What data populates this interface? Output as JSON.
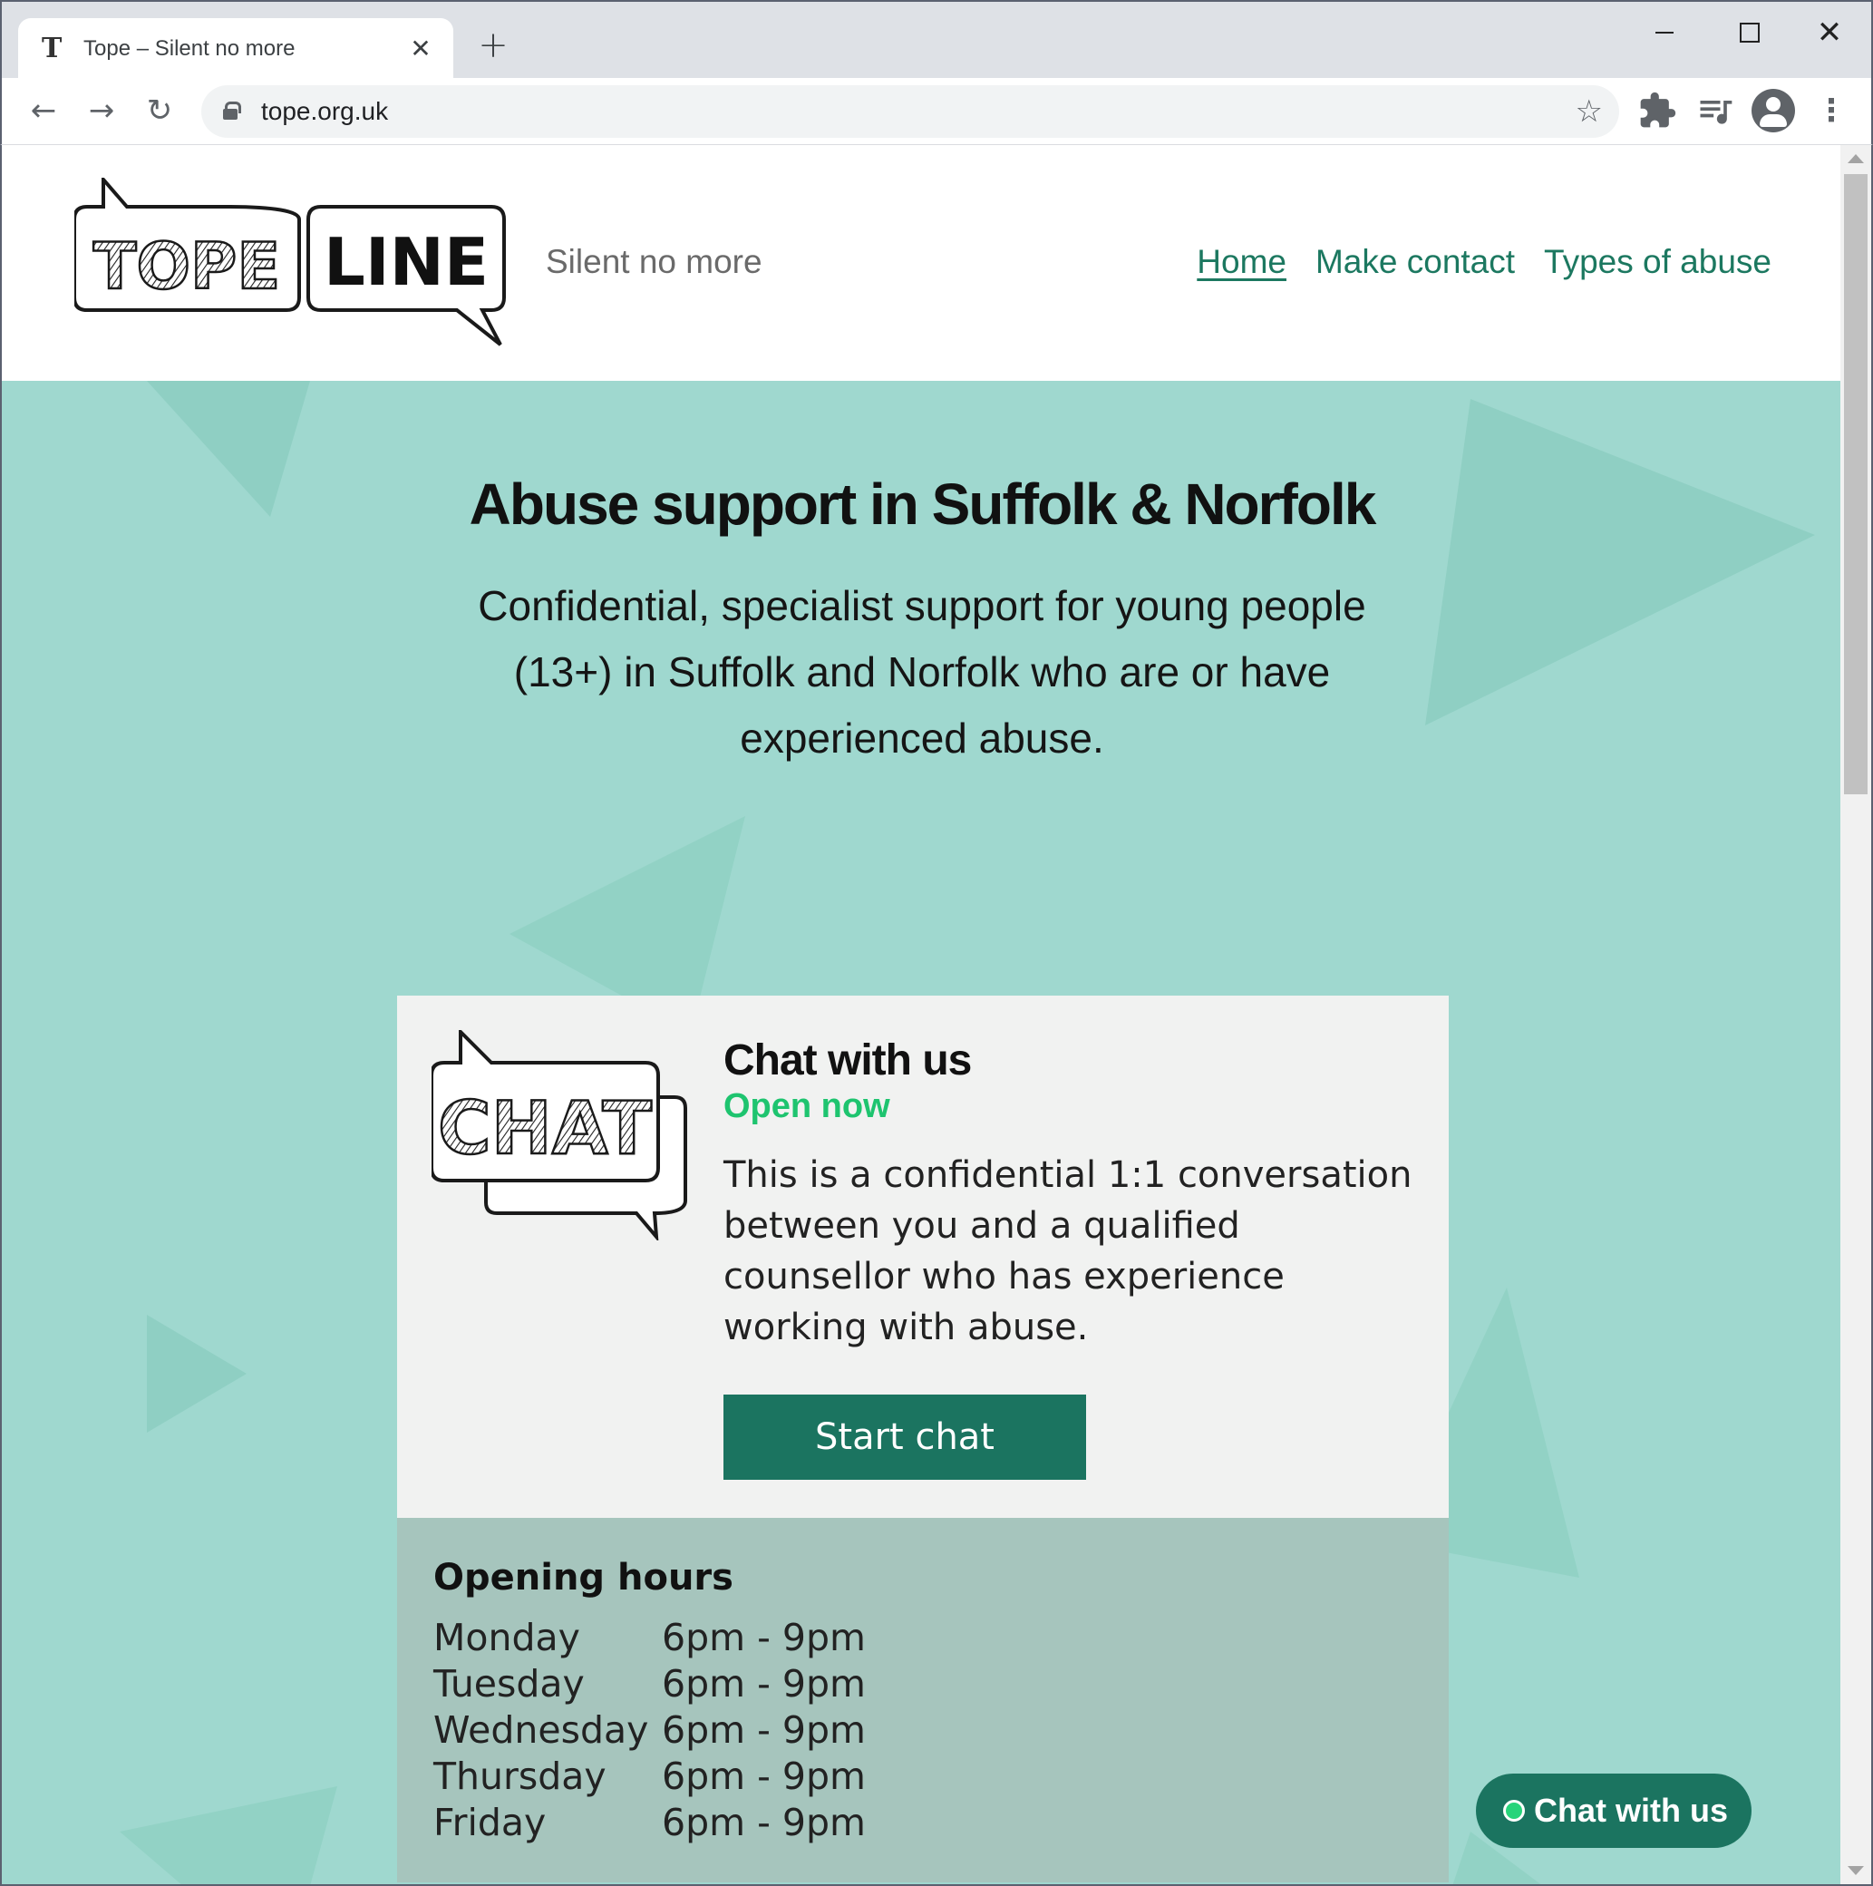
{
  "browser": {
    "tab_title": "Tope – Silent no more",
    "tab_favicon": "T",
    "url": "tope.org.uk",
    "icons": {
      "back": "arrow-left",
      "forward": "arrow-right",
      "reload": "reload",
      "lock": "lock",
      "bookmark": "star",
      "extensions": "puzzle",
      "media": "media-queue",
      "profile": "account-circle",
      "menu": "kebab-menu"
    }
  },
  "site": {
    "logo_text_left": "TOPE",
    "logo_text_right": "LINE",
    "tagline": "Silent no more",
    "nav": [
      {
        "label": "Home",
        "active": true
      },
      {
        "label": "Make contact",
        "active": false
      },
      {
        "label": "Types of abuse",
        "active": false
      }
    ]
  },
  "hero": {
    "title": "Abuse support in Suffolk & Norfolk",
    "subtitle": "Confidential, specialist support for young people (13+) in Suffolk and Norfolk who are or have experienced abuse."
  },
  "chat_card": {
    "logo_text": "CHAT",
    "title": "Chat with us",
    "status": "Open now",
    "body": "This is a confidential 1:1 conversation between you and a qualified counsellor who has experience working with abuse.",
    "button_label": "Start chat"
  },
  "opening_hours": {
    "title": "Opening hours",
    "rows": [
      {
        "day": "Monday",
        "time": "6pm - 9pm"
      },
      {
        "day": "Tuesday",
        "time": "6pm - 9pm"
      },
      {
        "day": "Wednesday",
        "time": "6pm - 9pm"
      },
      {
        "day": "Thursday",
        "time": "6pm - 9pm"
      },
      {
        "day": "Friday",
        "time": "6pm - 9pm"
      }
    ]
  },
  "floating_chat": {
    "label": "Chat with us"
  },
  "colors": {
    "brand_green": "#1b7460",
    "hero_bg": "#9fd8cf",
    "open_status": "#1ec46f",
    "hours_bg": "#a6c5bd"
  }
}
